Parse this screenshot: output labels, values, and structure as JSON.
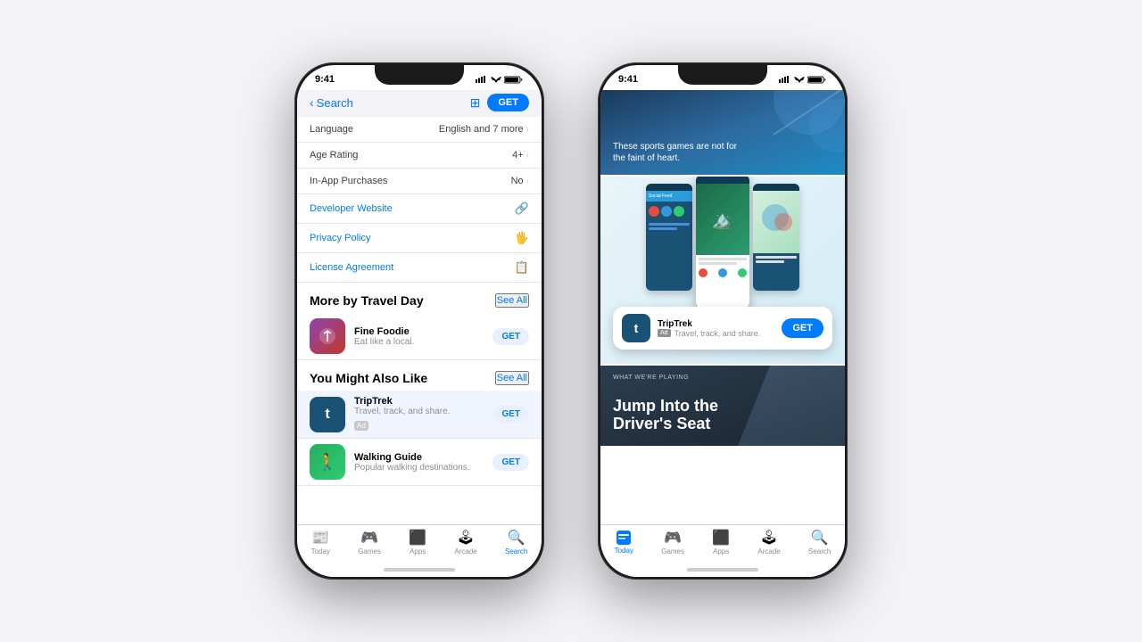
{
  "background_color": "#f2f2f7",
  "phone1": {
    "status_bar": {
      "time": "9:41",
      "icons": "▐▐▐ ◀ 🔋"
    },
    "nav": {
      "back_label": "Search",
      "list_icon": "≡",
      "get_label": "GET"
    },
    "info_rows": [
      {
        "label": "Language",
        "value": "English and 7 more"
      },
      {
        "label": "Age Rating",
        "value": "4+"
      },
      {
        "label": "In-App Purchases",
        "value": "No"
      }
    ],
    "link_rows": [
      {
        "label": "Developer Website",
        "icon": "🔗"
      },
      {
        "label": "Privacy Policy",
        "icon": "🖐"
      },
      {
        "label": "License Agreement",
        "icon": "📋"
      }
    ],
    "more_by": {
      "section_title": "More by Travel Day",
      "see_all": "See All",
      "apps": [
        {
          "name": "Fine Foodie",
          "desc": "Eat like a local.",
          "get_label": "GET",
          "icon_letter": "🍴"
        }
      ]
    },
    "also_like": {
      "section_title": "You Might Also Like",
      "see_all": "See All",
      "apps": [
        {
          "name": "TripTrek",
          "desc": "Travel, track, and share.",
          "ad": true,
          "get_label": "GET",
          "icon_letter": "t",
          "highlighted": true
        },
        {
          "name": "Walking Guide",
          "desc": "Popular walking destinations.",
          "get_label": "GET",
          "icon_letter": "🚶"
        }
      ]
    },
    "tab_bar": {
      "items": [
        {
          "label": "Today",
          "icon": "📰",
          "active": false
        },
        {
          "label": "Games",
          "icon": "🎮",
          "active": false
        },
        {
          "label": "Apps",
          "icon": "⬛",
          "active": false
        },
        {
          "label": "Arcade",
          "icon": "🕹",
          "active": false
        },
        {
          "label": "Search",
          "icon": "🔍",
          "active": true
        }
      ]
    }
  },
  "phone2": {
    "status_bar": {
      "time": "9:41"
    },
    "card_sports": {
      "text": "These sports games are not for\nthe faint of heart."
    },
    "card_social": {
      "app_name": "TripTrek",
      "ad_badge": "Ad",
      "tagline": "Travel, track, and share.",
      "get_label": "GET"
    },
    "card_jump": {
      "label": "WHAT WE'RE PLAYING",
      "title": "Jump Into the\nDriver's Seat"
    },
    "tab_bar": {
      "items": [
        {
          "label": "Today",
          "icon": "📰",
          "active": true
        },
        {
          "label": "Games",
          "icon": "🎮",
          "active": false
        },
        {
          "label": "Apps",
          "icon": "⬛",
          "active": false
        },
        {
          "label": "Arcade",
          "icon": "🕹",
          "active": false
        },
        {
          "label": "Search",
          "icon": "🔍",
          "active": false
        }
      ]
    }
  }
}
